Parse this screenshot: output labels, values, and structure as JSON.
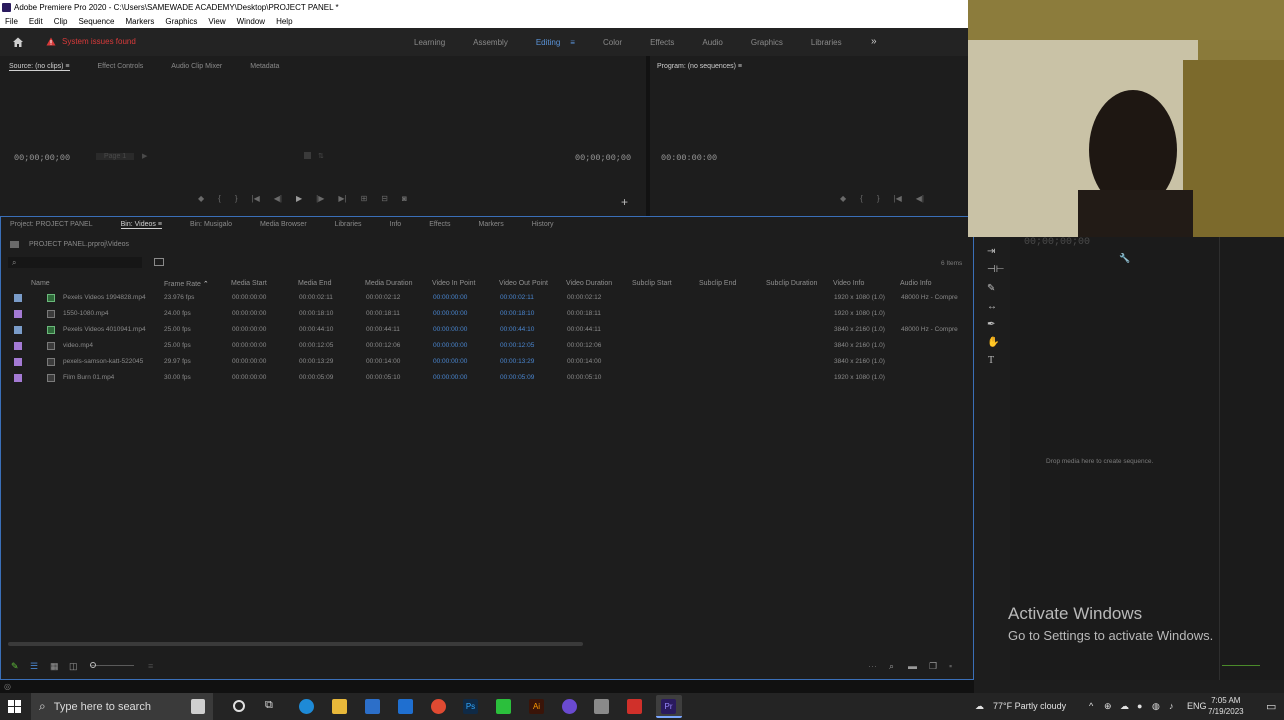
{
  "window": {
    "title": "Adobe Premiere Pro 2020 - C:\\Users\\SAMEWADE ACADEMY\\Desktop\\PROJECT PANEL *"
  },
  "menu": [
    "File",
    "Edit",
    "Clip",
    "Sequence",
    "Markers",
    "Graphics",
    "View",
    "Window",
    "Help"
  ],
  "workspace": {
    "warning": "System issues found",
    "tabs": [
      "Learning",
      "Assembly",
      "Editing",
      "Color",
      "Effects",
      "Audio",
      "Graphics",
      "Libraries"
    ],
    "active_tab": "Editing",
    "more": "»"
  },
  "source_panel": {
    "tabs": [
      "Source: (no clips)",
      "Effect Controls",
      "Audio Clip Mixer",
      "Metadata"
    ],
    "timecode_left": "00;00;00;00",
    "timecode_right": "00;00;00;00",
    "page_fraction": "Page 1"
  },
  "program_panel": {
    "tab": "Program: (no sequences)",
    "timecode": "00:00:00:00"
  },
  "project_panel": {
    "tabs": [
      "Project: PROJECT PANEL",
      "Bin: Videos",
      "Bin: Musigalo",
      "Media Browser",
      "Libraries",
      "Info",
      "Effects",
      "Markers",
      "History"
    ],
    "path": "PROJECT PANEL.prproj\\Videos",
    "items_count": "6 Items",
    "columns": [
      "Name",
      "Frame Rate",
      "Media Start",
      "Media End",
      "Media Duration",
      "Video In Point",
      "Video Out Point",
      "Video Duration",
      "Subclip Start",
      "Subclip End",
      "Subclip Duration",
      "Video Info",
      "Audio Info"
    ],
    "rows": [
      {
        "name": "Pexels Videos 1994828.mp4",
        "frame_rate": "23.976 fps",
        "media_start": "00:00:00:00",
        "media_end": "00:00:02:11",
        "media_duration": "00:00:02:12",
        "in": "00:00:00:00",
        "out": "00:00:02:11",
        "vdur": "00:00:02:12",
        "video_info": "1920 x 1080 (1.0)",
        "audio_info": "48000 Hz - Compre",
        "color": "#7a9cc9",
        "has_audio": true
      },
      {
        "name": "1550-1080.mp4",
        "frame_rate": "24.00 fps",
        "media_start": "00:00:00:00",
        "media_end": "00:00:18:10",
        "media_duration": "00:00:18:11",
        "in": "00:00:00:00",
        "out": "00:00:18:10",
        "vdur": "00:00:18:11",
        "video_info": "1920 x 1080 (1.0)",
        "audio_info": "",
        "color": "#a47ad4",
        "has_audio": false
      },
      {
        "name": "Pexels Videos 4010941.mp4",
        "frame_rate": "25.00 fps",
        "media_start": "00:00:00:00",
        "media_end": "00:00:44:10",
        "media_duration": "00:00:44:11",
        "in": "00:00:00:00",
        "out": "00:00:44:10",
        "vdur": "00:00:44:11",
        "video_info": "3840 x 2160 (1.0)",
        "audio_info": "48000 Hz - Compre",
        "color": "#7a9cc9",
        "has_audio": true
      },
      {
        "name": "video.mp4",
        "frame_rate": "25.00 fps",
        "media_start": "00:00:00:00",
        "media_end": "00:00:12:05",
        "media_duration": "00:00:12:06",
        "in": "00:00:00:00",
        "out": "00:00:12:05",
        "vdur": "00:00:12:06",
        "video_info": "3840 x 2160 (1.0)",
        "audio_info": "",
        "color": "#a47ad4",
        "has_audio": false
      },
      {
        "name": "pexels-samson-katt-522045",
        "frame_rate": "29.97 fps",
        "media_start": "00:00:00:00",
        "media_end": "00:00:13:29",
        "media_duration": "00:00:14:00",
        "in": "00:00:00:00",
        "out": "00:00:13:29",
        "vdur": "00:00:14:00",
        "video_info": "3840 x 2160 (1.0)",
        "audio_info": "",
        "color": "#a47ad4",
        "has_audio": false
      },
      {
        "name": "Film Burn 01.mp4",
        "frame_rate": "30.00 fps",
        "media_start": "00:00:00:00",
        "media_end": "00:00:05:09",
        "media_duration": "00:00:05:10",
        "in": "00:00:00:00",
        "out": "00:00:05:09",
        "vdur": "00:00:05:10",
        "video_info": "1920 x 1080 (1.0)",
        "audio_info": "",
        "color": "#a47ad4",
        "has_audio": false
      }
    ]
  },
  "timeline": {
    "timecode": "00;00;00;00",
    "drop_hint": "Drop media here to create sequence."
  },
  "activate_windows": {
    "line1": "Activate Windows",
    "line2": "Go to Settings to activate Windows."
  },
  "taskbar": {
    "search_placeholder": "Type here to search",
    "weather": "77°F  Partly cloudy",
    "lang": "ENG",
    "time": "7:05 AM",
    "date": "7/19/2023"
  }
}
